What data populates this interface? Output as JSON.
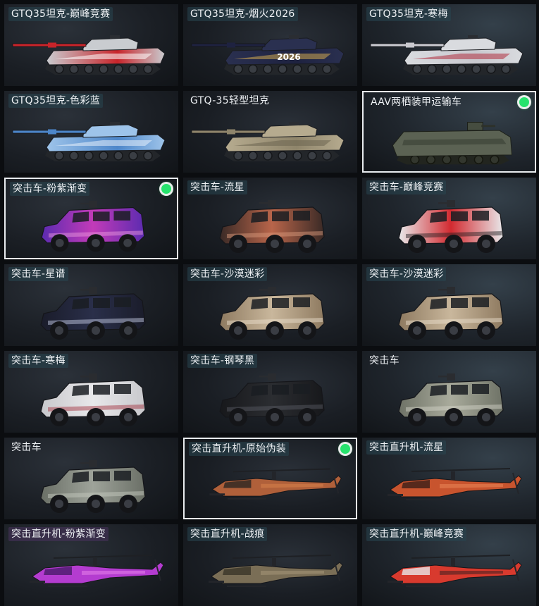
{
  "cards": [
    {
      "label": "GTQ35坦克-巅峰竞赛",
      "type": "tank",
      "c1": "#c9ccd0",
      "c2": "#c8242a",
      "c3": "#ffffff",
      "decal": "",
      "selected": false,
      "label_style": "teal"
    },
    {
      "label": "GTQ35坦克-烟火2026",
      "type": "tank",
      "c1": "#2a3050",
      "c2": "#1e2240",
      "c3": "#d0a850",
      "decal": "2026",
      "selected": false,
      "label_style": "teal"
    },
    {
      "label": "GTQ35坦克-寒梅",
      "type": "tank",
      "c1": "#d9dbdf",
      "c2": "#c9c9cf",
      "c3": "#b03040",
      "decal": "",
      "selected": false,
      "label_style": "teal"
    },
    {
      "label": "GTQ35坦克-色彩蓝",
      "type": "tank",
      "c1": "#9ec4ea",
      "c2": "#4d86c9",
      "c3": "#e8f1fb",
      "decal": "",
      "selected": false,
      "label_style": "teal"
    },
    {
      "label": "GTQ-35轻型坦克",
      "type": "tank",
      "c1": "#b6ab8f",
      "c2": "#8f856b",
      "c3": "#6b6450",
      "decal": "",
      "selected": false,
      "label_style": "plain"
    },
    {
      "label": "AAV两栖装甲运输车",
      "type": "aav",
      "c1": "#5b6253",
      "c2": "#464d40",
      "c3": "#2d312a",
      "decal": "",
      "selected": true,
      "label_style": "plain"
    },
    {
      "label": "突击车-粉紫渐变",
      "type": "car",
      "c1": "#c23bb8",
      "c2": "#5c2bb0",
      "c3": "#f0a0e0",
      "decal": "",
      "selected": true,
      "label_style": "teal"
    },
    {
      "label": "突击车-流星",
      "type": "car",
      "c1": "#b8654a",
      "c2": "#3a2a26",
      "c3": "#e0a080",
      "decal": "",
      "selected": false,
      "label_style": "teal"
    },
    {
      "label": "突击车-巅峰竞赛",
      "type": "car",
      "c1": "#d22a30",
      "c2": "#e8e8ea",
      "c3": "#1a1a1c",
      "decal": "",
      "selected": false,
      "label_style": "teal"
    },
    {
      "label": "突击车-星谱",
      "type": "car",
      "c1": "#2a2f4a",
      "c2": "#1a1c2a",
      "c3": "#d0d8f0",
      "decal": "",
      "selected": false,
      "label_style": "teal"
    },
    {
      "label": "突击车-沙漠迷彩",
      "type": "car",
      "c1": "#c9b79c",
      "c2": "#8e7a60",
      "c3": "#efe4d2",
      "decal": "",
      "selected": false,
      "label_style": "teal"
    },
    {
      "label": "突击车-沙漠迷彩",
      "type": "car",
      "c1": "#c9b79c",
      "c2": "#8e7a60",
      "c3": "#efe4d2",
      "decal": "",
      "selected": false,
      "label_style": "teal"
    },
    {
      "label": "突击车-寒梅",
      "type": "car",
      "c1": "#e8e8ea",
      "c2": "#c8c8cc",
      "c3": "#a02a38",
      "decal": "",
      "selected": false,
      "label_style": "teal"
    },
    {
      "label": "突击车-钢琴黑",
      "type": "car",
      "c1": "#2b2d31",
      "c2": "#17181b",
      "c3": "#5a5e66",
      "decal": "",
      "selected": false,
      "label_style": "teal"
    },
    {
      "label": "突击车",
      "type": "car",
      "c1": "#a9ab9c",
      "c2": "#6e7266",
      "c3": "#d6d8cc",
      "decal": "",
      "selected": false,
      "label_style": "plain"
    },
    {
      "label": "突击车",
      "type": "car",
      "c1": "#9ea39a",
      "c2": "#6a6f66",
      "c3": "#c9cec4",
      "decal": "",
      "selected": false,
      "label_style": "plain"
    },
    {
      "label": "突击直升机-原始伪装",
      "type": "heli",
      "c1": "#b0603a",
      "c2": "#2a2622",
      "c3": "#e08a50",
      "decal": "",
      "selected": true,
      "label_style": "teal"
    },
    {
      "label": "突击直升机-流星",
      "type": "heli",
      "c1": "#c8542e",
      "c2": "#3a1e18",
      "c3": "#f09060",
      "decal": "",
      "selected": false,
      "label_style": "teal"
    },
    {
      "label": "突击直升机-粉紫渐变",
      "type": "heli",
      "c1": "#b43cd0",
      "c2": "#4a1a6a",
      "c3": "#f090f0",
      "decal": "",
      "selected": false,
      "label_style": "purple"
    },
    {
      "label": "突击直升机-战痕",
      "type": "heli",
      "c1": "#7a6e56",
      "c2": "#3a3428",
      "c3": "#b0a080",
      "decal": "",
      "selected": false,
      "label_style": "teal"
    },
    {
      "label": "突击直升机-巅峰竞赛",
      "type": "heli",
      "c1": "#d83a2e",
      "c2": "#e8e8ea",
      "c3": "#1a1a1c",
      "decal": "",
      "selected": false,
      "label_style": "teal"
    }
  ]
}
